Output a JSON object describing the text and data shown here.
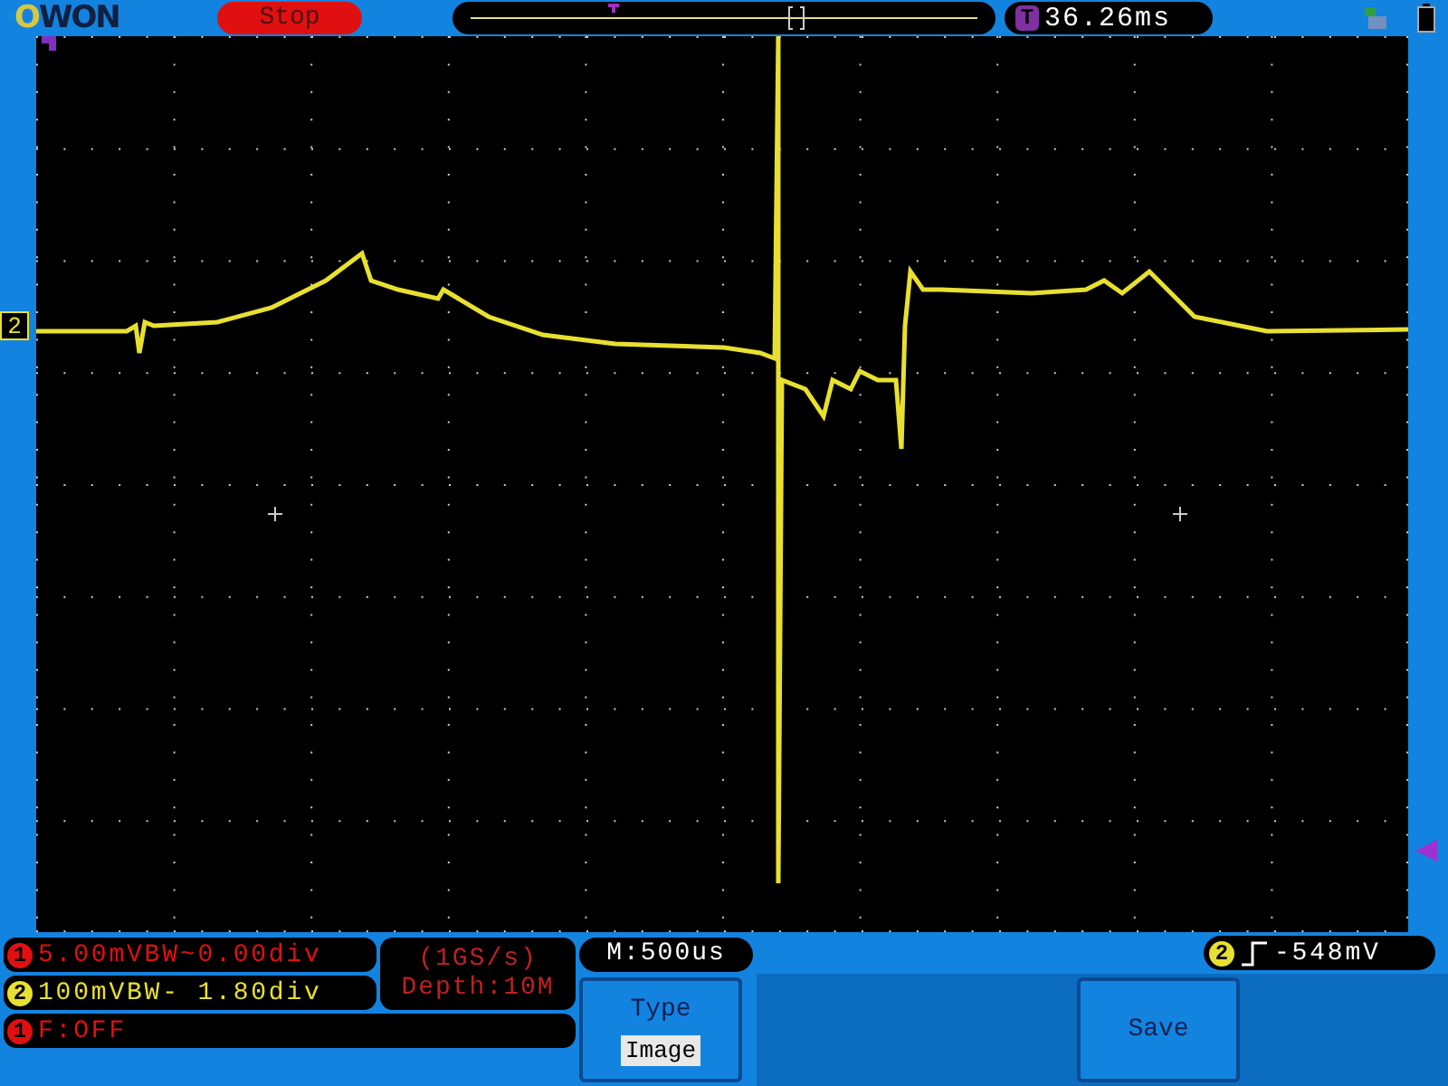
{
  "top_bar": {
    "logo": "OWON",
    "run_state": "Stop",
    "time_readout": {
      "icon": "T",
      "value": "36.26ms"
    }
  },
  "channel_marker": {
    "label": "2",
    "color": "#e8e030"
  },
  "channels": [
    {
      "badge": "1",
      "color": "#e01010",
      "readout": "5.00mVBW~0.00div"
    },
    {
      "badge": "2",
      "color": "#e8e030",
      "readout": "100mVBW- 1.80div"
    }
  ],
  "sample": {
    "rate": "(1GS/s)",
    "depth": "Depth:10M"
  },
  "filter": {
    "badge": "1",
    "color": "#e01010",
    "readout": "F:OFF"
  },
  "timebase": "M:500us",
  "menu": [
    {
      "title": "Type",
      "value": "Image"
    },
    {
      "title": "Save"
    }
  ],
  "trigger": {
    "badge": "2",
    "color": "#e8e030",
    "reading": "-548mV"
  }
}
